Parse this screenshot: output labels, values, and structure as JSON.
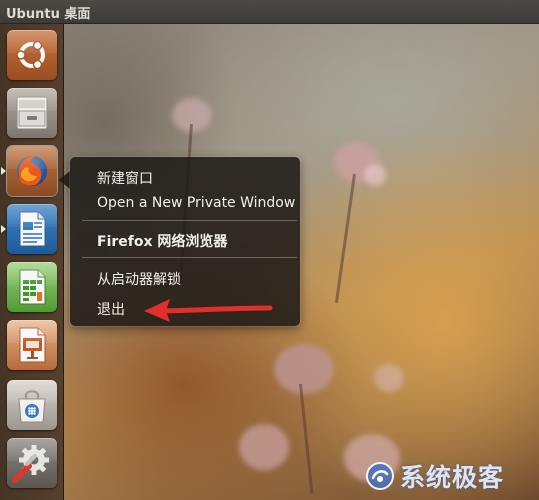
{
  "top_panel": {
    "title": "Ubuntu 桌面"
  },
  "launcher": {
    "items": [
      {
        "name": "dash-home",
        "icon": "ubuntu-logo-icon"
      },
      {
        "name": "files",
        "icon": "file-cabinet-icon"
      },
      {
        "name": "firefox",
        "icon": "firefox-icon",
        "running": true
      },
      {
        "name": "libreoffice-writer",
        "icon": "writer-document-icon",
        "running": true
      },
      {
        "name": "libreoffice-calc",
        "icon": "calc-spreadsheet-icon"
      },
      {
        "name": "libreoffice-impress",
        "icon": "impress-presentation-icon"
      },
      {
        "name": "ubuntu-software-center",
        "icon": "shopping-bag-icon"
      },
      {
        "name": "system-settings",
        "icon": "gear-wrench-icon"
      }
    ]
  },
  "context_menu": {
    "items": [
      {
        "label": "新建窗口",
        "bold": false
      },
      {
        "label": "Open a New Private Window",
        "bold": false
      },
      {
        "label": "Firefox 网络浏览器",
        "bold": true
      },
      {
        "label": "从启动器解锁",
        "bold": false
      },
      {
        "label": "退出",
        "bold": false
      }
    ]
  },
  "annotation": {
    "arrow_color": "#e0302c",
    "points_to": "退出"
  },
  "watermark": {
    "text": "系统极客"
  },
  "colors": {
    "panel": "#3c3b37",
    "launcher": "#5a4130",
    "menu_bg": "#1c1816",
    "menu_text": "#f2f0ec",
    "accent_red": "#e0302c"
  }
}
